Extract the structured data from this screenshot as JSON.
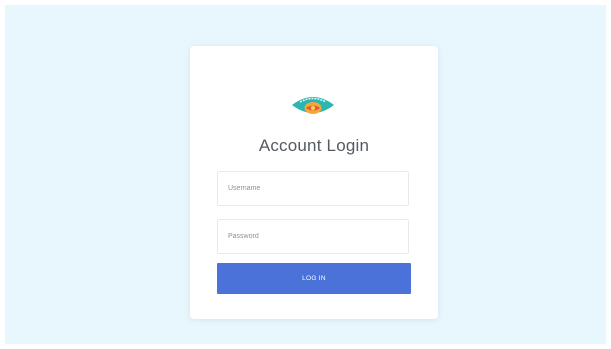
{
  "login": {
    "title": "Account Login",
    "username": {
      "value": "",
      "placeholder": "Username"
    },
    "password": {
      "value": "",
      "placeholder": "Password"
    },
    "submit_label": "LOG IN"
  },
  "logo": {
    "icon": "eye-shaped-brand-logo",
    "colors": {
      "outer": "#2bb6b0",
      "inner": "#f4a83a",
      "accent": "#e5543a"
    }
  },
  "colors": {
    "page_background": "#e8f7fd",
    "card_background": "#ffffff",
    "button": "#4a72d8",
    "title_text": "#555a60"
  }
}
